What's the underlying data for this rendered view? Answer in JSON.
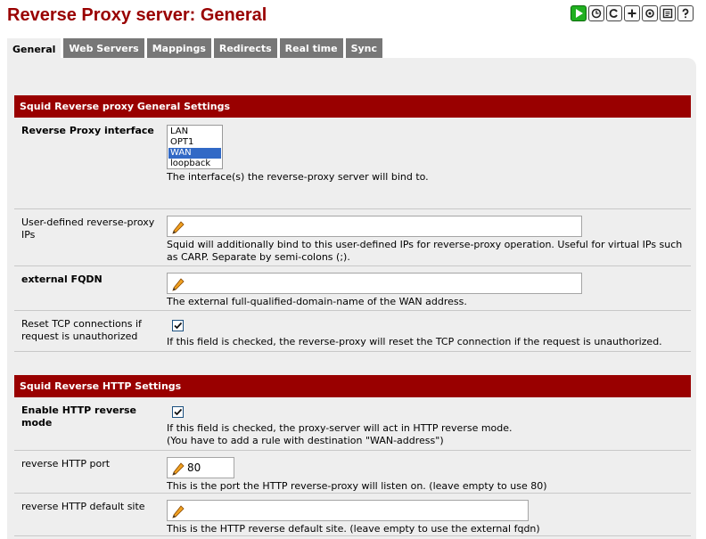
{
  "page": {
    "title": "Reverse Proxy server: General"
  },
  "icons": [
    "play-icon",
    "status-icon",
    "system-icon",
    "add-icon",
    "settings-icon",
    "log-icon",
    "help-icon"
  ],
  "tabs": [
    {
      "label": "General",
      "active": true
    },
    {
      "label": "Web Servers",
      "active": false
    },
    {
      "label": "Mappings",
      "active": false
    },
    {
      "label": "Redirects",
      "active": false
    },
    {
      "label": "Real time",
      "active": false
    },
    {
      "label": "Sync",
      "active": false
    }
  ],
  "colors": {
    "brand": "#990000",
    "tab": "#777777",
    "panel": "#eeeeee",
    "selection": "#3169c6"
  },
  "general": {
    "header": "Squid Reverse proxy General Settings",
    "interface": {
      "label": "Reverse Proxy interface",
      "options": [
        "LAN",
        "OPT1",
        "WAN",
        "loopback"
      ],
      "selected": "WAN",
      "desc": "The interface(s) the reverse-proxy server will bind to."
    },
    "ips": {
      "label": "User-defined reverse-proxy IPs",
      "value": "",
      "desc": "Squid will additionally bind to this user-defined IPs for reverse-proxy operation. Useful for virtual IPs such as CARP. Separate by semi-colons (;)."
    },
    "fqdn": {
      "label": "external FQDN",
      "value": "",
      "desc": "The external full-qualified-domain-name of the WAN address."
    },
    "reset": {
      "label": "Reset TCP connections if request is unauthorized",
      "checked": true,
      "desc": "If this field is checked, the reverse-proxy will reset the TCP connection if the request is unauthorized."
    }
  },
  "http": {
    "header": "Squid Reverse HTTP Settings",
    "enable": {
      "label": "Enable HTTP reverse mode",
      "checked": true,
      "desc1": "If this field is checked, the proxy-server will act in HTTP reverse mode.",
      "desc2": "(You have to add a rule with destination \"WAN-address\")"
    },
    "port": {
      "label": "reverse HTTP port",
      "value": "80",
      "desc": "This is the port the HTTP reverse-proxy will listen on. (leave empty to use 80)"
    },
    "default_site": {
      "label": "reverse HTTP default site",
      "value": "",
      "desc": "This is the HTTP reverse default site. (leave empty to use the external fqdn)"
    }
  }
}
